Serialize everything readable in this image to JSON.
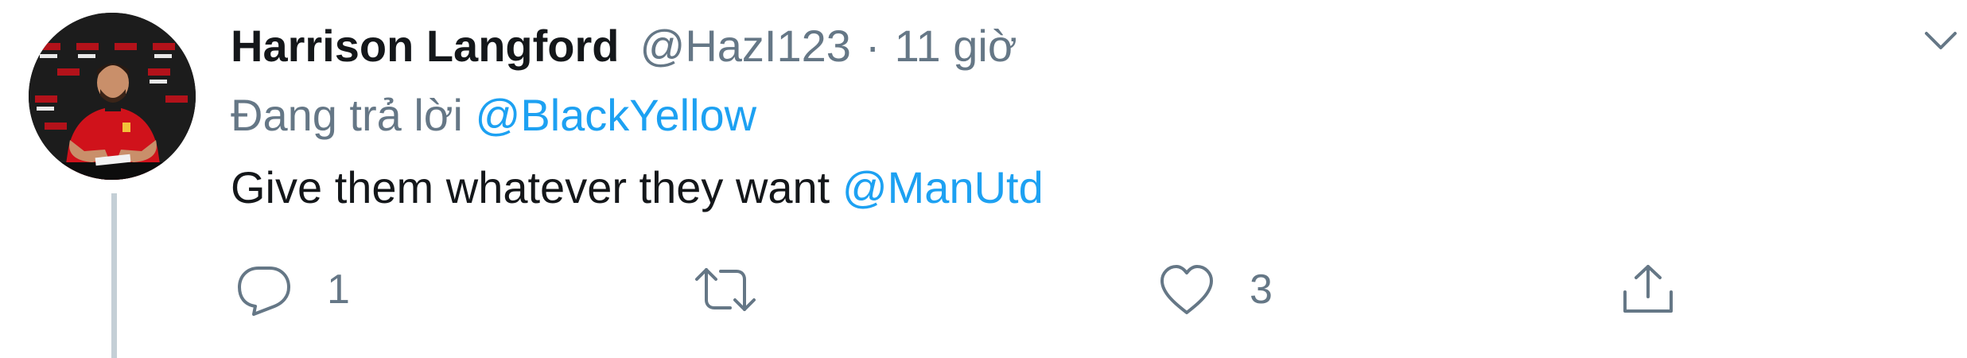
{
  "tweet": {
    "display_name": "Harrison Langford",
    "handle": "@HazI123",
    "separator": "·",
    "time": "11 giờ",
    "reply_prefix": "Đang trả lời",
    "reply_to": "@BlackYellow",
    "text": "Give them whatever they want",
    "mention": "@ManUtd"
  },
  "actions": {
    "reply_count": "1",
    "retweet_count": "",
    "like_count": "3"
  },
  "icons": {
    "reply": "reply-icon",
    "retweet": "retweet-icon",
    "like": "heart-icon",
    "share": "share-icon",
    "more": "chevron-down-icon"
  },
  "colors": {
    "link": "#1da1f2",
    "muted": "#657786",
    "text": "#14171a",
    "thread_line": "#c4cfd6",
    "jersey": "#d0121b"
  }
}
